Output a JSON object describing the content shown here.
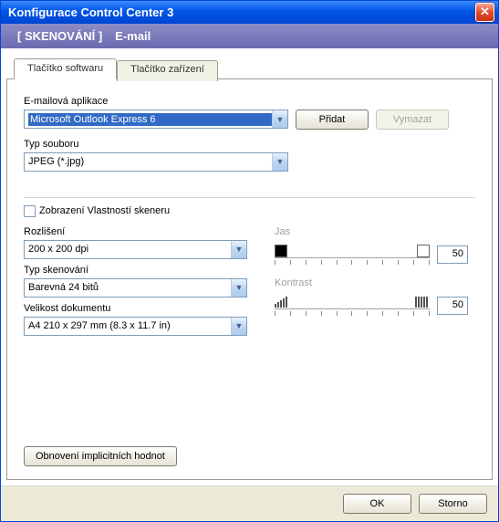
{
  "window": {
    "title": "Konfigurace Control Center 3"
  },
  "breadcrumb": {
    "section": "[  SKENOVÁNÍ  ]",
    "sub": "E-mail"
  },
  "tabs": [
    {
      "label": "Tlačítko softwaru",
      "active": true
    },
    {
      "label": "Tlačítko zařízení",
      "active": false
    }
  ],
  "email_app": {
    "label": "E-mailová aplikace",
    "value": "Microsoft Outlook Express 6",
    "add_btn": "Přidat",
    "delete_btn": "Vymazat"
  },
  "file_type": {
    "label": "Typ souboru",
    "value": "JPEG (*.jpg)"
  },
  "scanner_props_checkbox": "Zobrazení Vlastností skeneru",
  "resolution": {
    "label": "Rozlišení",
    "value": "200 x 200 dpi"
  },
  "scan_type": {
    "label": "Typ skenování",
    "value": "Barevná 24 bitů"
  },
  "doc_size": {
    "label": "Velikost dokumentu",
    "value": "A4 210 x 297 mm (8.3 x 11.7 in)"
  },
  "brightness": {
    "label": "Jas",
    "value": "50"
  },
  "contrast": {
    "label": "Kontrast",
    "value": "50"
  },
  "restore_btn": "Obnovení implicitních hodnot",
  "footer": {
    "ok": "OK",
    "cancel": "Storno"
  }
}
